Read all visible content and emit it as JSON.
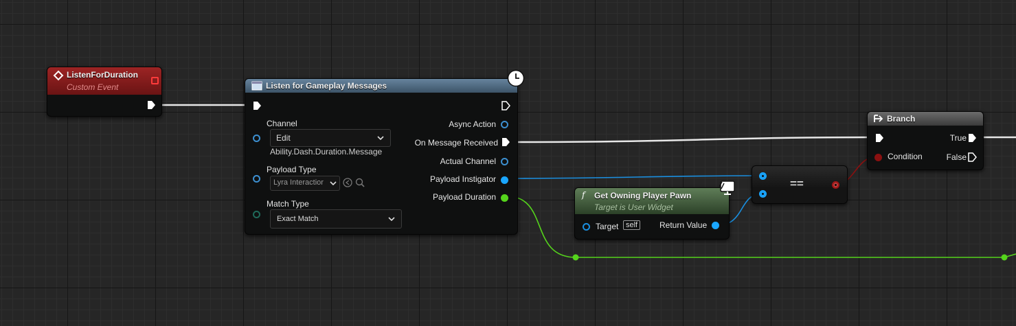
{
  "nodes": {
    "custom_event": {
      "title": "ListenForDuration",
      "subtitle": "Custom Event",
      "header_color": "#8a1f1f"
    },
    "listen_messages": {
      "title": "Listen for Gameplay Messages",
      "header_color": "#4f6b84",
      "inputs": {
        "channel_label": "Channel",
        "channel_combo": "Edit",
        "channel_value": "Ability.Dash.Duration.Message",
        "payload_type_label": "Payload Type",
        "payload_type_combo": "Lyra Interactior",
        "match_type_label": "Match Type",
        "match_type_combo": "Exact Match"
      },
      "outputs": {
        "async_action": "Async Action",
        "on_message_received": "On Message Received",
        "actual_channel": "Actual Channel",
        "payload_instigator": "Payload Instigator",
        "payload_duration": "Payload Duration"
      }
    },
    "get_owning_pawn": {
      "title": "Get Owning Player Pawn",
      "subtitle": "Target is User Widget",
      "header_color": "#3d5a3a",
      "target_label": "Target",
      "target_default": "self",
      "return_label": "Return Value"
    },
    "equals": {
      "label": "=="
    },
    "branch": {
      "title": "Branch",
      "condition_label": "Condition",
      "true_label": "True",
      "false_label": "False"
    }
  },
  "colors": {
    "exec": "#ffffff",
    "object_pin": "#1aa6ff",
    "struct_pin": "#1f8a5a",
    "float_pin": "#55d41c",
    "bool_pin": "#a41616",
    "async_channel_pin": "#3c8fd0"
  },
  "icons": [
    "event-diamond-icon",
    "delegate-square-icon",
    "function-icon",
    "clock-icon",
    "widget-monitor-icon",
    "branch-icon",
    "search-icon",
    "browse-icon",
    "chevron-down-icon"
  ]
}
